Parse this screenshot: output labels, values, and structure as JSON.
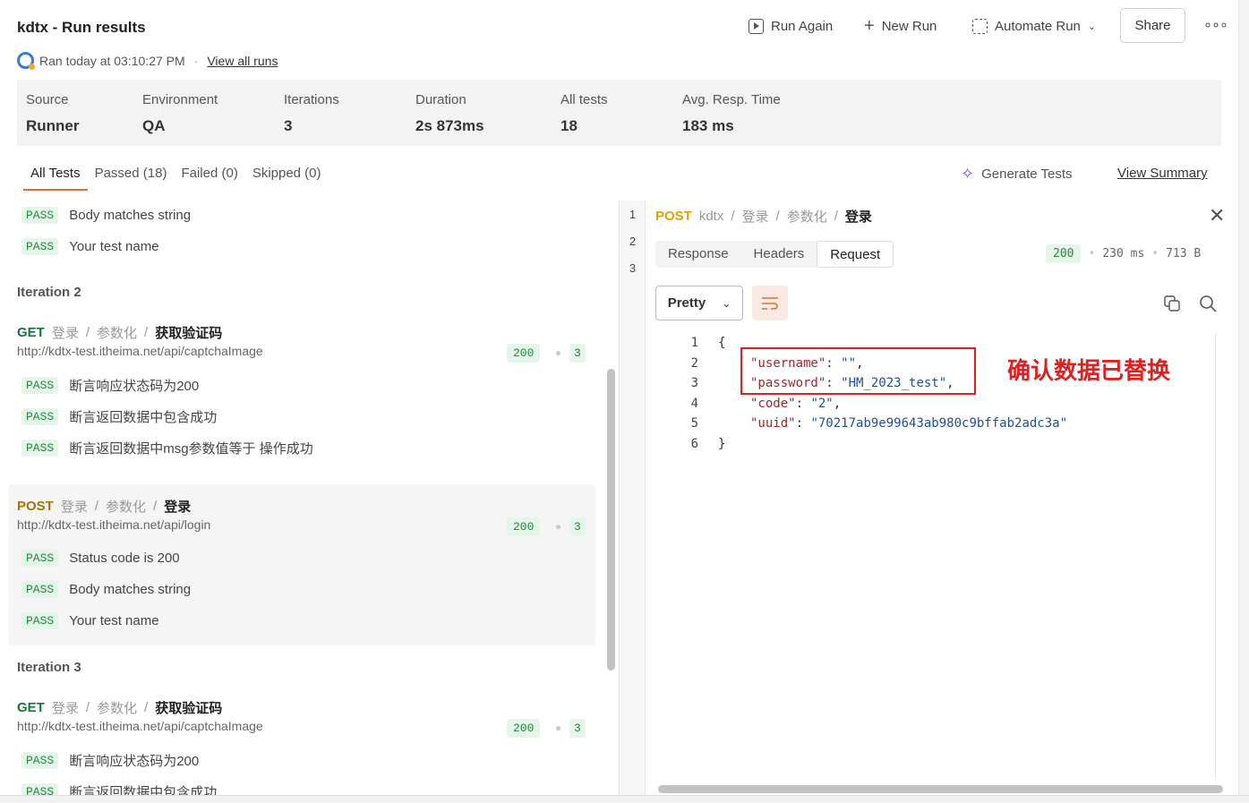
{
  "header": {
    "title": "kdtx - Run results",
    "ran_text": "Ran today at 03:10:27 PM",
    "view_all_runs": "View all runs"
  },
  "toolbar": {
    "run_again": "Run Again",
    "new_run": "New Run",
    "automate_run": "Automate Run",
    "share": "Share"
  },
  "stats": [
    {
      "label": "Source",
      "value": "Runner"
    },
    {
      "label": "Environment",
      "value": "QA"
    },
    {
      "label": "Iterations",
      "value": "3"
    },
    {
      "label": "Duration",
      "value": "2s 873ms"
    },
    {
      "label": "All tests",
      "value": "18"
    },
    {
      "label": "Avg. Resp. Time",
      "value": "183 ms"
    }
  ],
  "filter_tabs": [
    "All Tests",
    "Passed (18)",
    "Failed (0)",
    "Skipped (0)"
  ],
  "generate_tests": "Generate Tests",
  "view_summary": "View Summary",
  "pass_label": "PASS",
  "left": {
    "top_tests": [
      "Body matches string",
      "Your test name"
    ],
    "iteration2": "Iteration 2",
    "iteration3": "Iteration 3",
    "get_req": {
      "method": "GET",
      "crumb1": "登录",
      "crumb2": "参数化",
      "name": "获取验证码",
      "url": "http://kdtx-test.itheima.net/api/captchaImage",
      "code": "200",
      "count": "3",
      "tests": [
        "断言响应状态码为200",
        "断言返回数据中包含成功",
        "断言返回数据中msg参数值等于 操作成功"
      ]
    },
    "post_req": {
      "method": "POST",
      "crumb1": "登录",
      "crumb2": "参数化",
      "name": "登录",
      "url": "http://kdtx-test.itheima.net/api/login",
      "code": "200",
      "count": "3",
      "tests": [
        "Status code is 200",
        "Body matches string",
        "Your test name"
      ]
    },
    "get_req3_tests": [
      "断言响应状态码为200",
      "断言返回数据中包含成功"
    ],
    "sep": "/"
  },
  "gutter": [
    "1",
    "2",
    "3"
  ],
  "right": {
    "method": "POST",
    "crumbs": [
      "kdtx",
      "登录",
      "参数化"
    ],
    "name": "登录",
    "subtabs": [
      "Response",
      "Headers",
      "Request"
    ],
    "status_code": "200",
    "time": "230 ms",
    "size": "713 B",
    "pretty": "Pretty",
    "code_lines": [
      "1",
      "2",
      "3",
      "4",
      "5",
      "6"
    ],
    "json": {
      "open": "{",
      "k1": "\"username\"",
      "v1": "\"\"",
      "k2": "\"password\"",
      "v2": "\"HM_2023_test\"",
      "k3": "\"code\"",
      "v3": "\"2\"",
      "k4": "\"uuid\"",
      "v4": "\"70217ab9e99643ab980c9bffab2adc3a\"",
      "close": "}"
    },
    "annotation": "确认数据已替换"
  },
  "colors": {
    "accent": "#e06a3c",
    "pass_green": "#1f8a3a",
    "annotation_red": "#e02020",
    "post": "#a97400",
    "get": "#117a3a"
  }
}
